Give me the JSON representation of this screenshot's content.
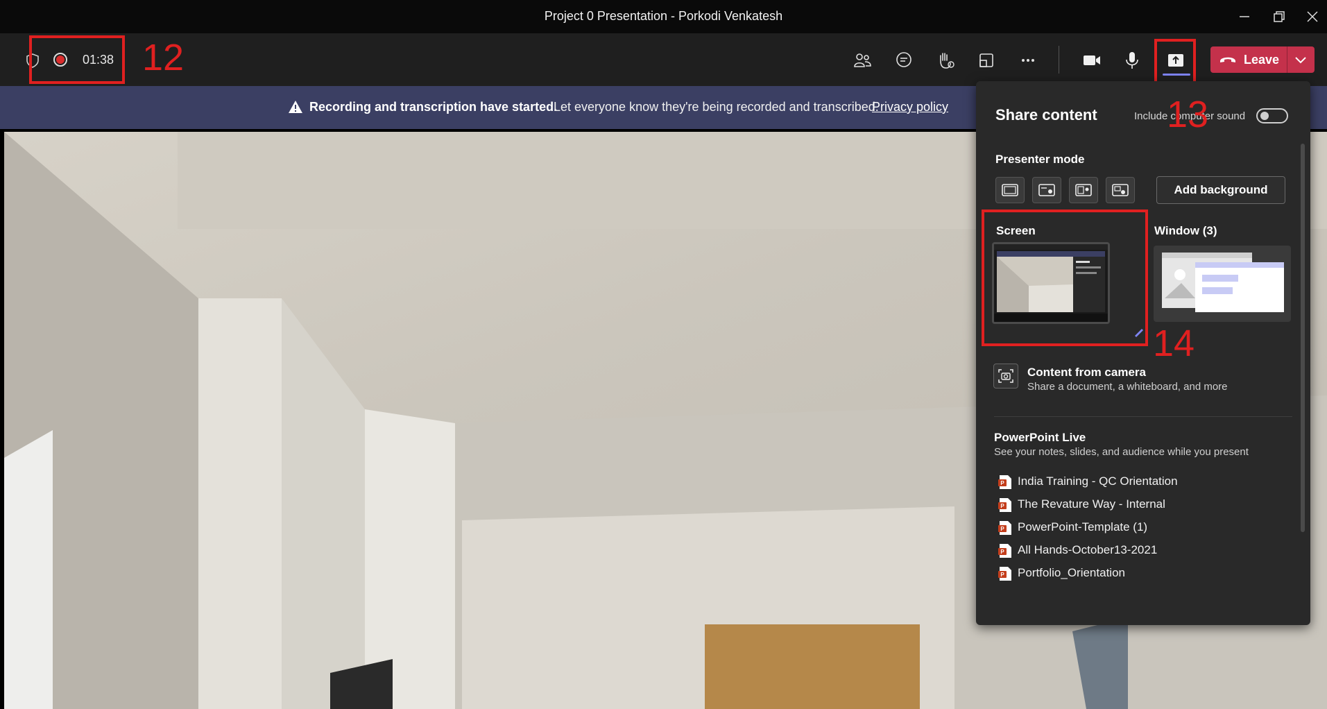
{
  "window": {
    "title": "Project 0 Presentation - Porkodi Venkatesh",
    "controls": [
      "minimize-icon",
      "restore-icon",
      "close-icon"
    ]
  },
  "toolbar": {
    "timer": "01:38",
    "icons": [
      "shield-icon",
      "record-icon",
      "people-icon",
      "chat-icon",
      "raise-hand-icon",
      "room-icon",
      "more-icon",
      "camera-icon",
      "mic-icon",
      "share-icon"
    ],
    "leave_label": "Leave"
  },
  "annotations": {
    "n12": "12",
    "n13": "13",
    "n14": "14",
    "color": "#e02020"
  },
  "banner": {
    "bold_text": "Recording and transcription have started.",
    "message": "Let everyone know they're being recorded and transcribed.",
    "link": "Privacy policy"
  },
  "share_panel": {
    "title": "Share content",
    "computer_sound_label": "Include computer sound",
    "computer_sound_on": false,
    "presenter_mode_label": "Presenter mode",
    "presenter_modes": [
      "content-only-icon",
      "standout-icon",
      "side-by-side-icon",
      "reporter-icon"
    ],
    "add_background_label": "Add background",
    "screen_label": "Screen",
    "window_label": "Window (3)",
    "camera_content": {
      "title": "Content from camera",
      "subtitle": "Share a document, a whiteboard, and more"
    },
    "powerpoint_live": {
      "title": "PowerPoint Live",
      "subtitle": "See your notes, slides, and audience while you present",
      "files": [
        "India Training - QC Orientation",
        "The Revature Way - Internal",
        "PowerPoint-Template (1)",
        "All Hands-October13-2021",
        "Portfolio_Orientation"
      ]
    }
  },
  "colors": {
    "leave_button": "#c4314b",
    "banner": "#3b3f63",
    "panel": "#292929",
    "accent": "#7f85f5"
  }
}
